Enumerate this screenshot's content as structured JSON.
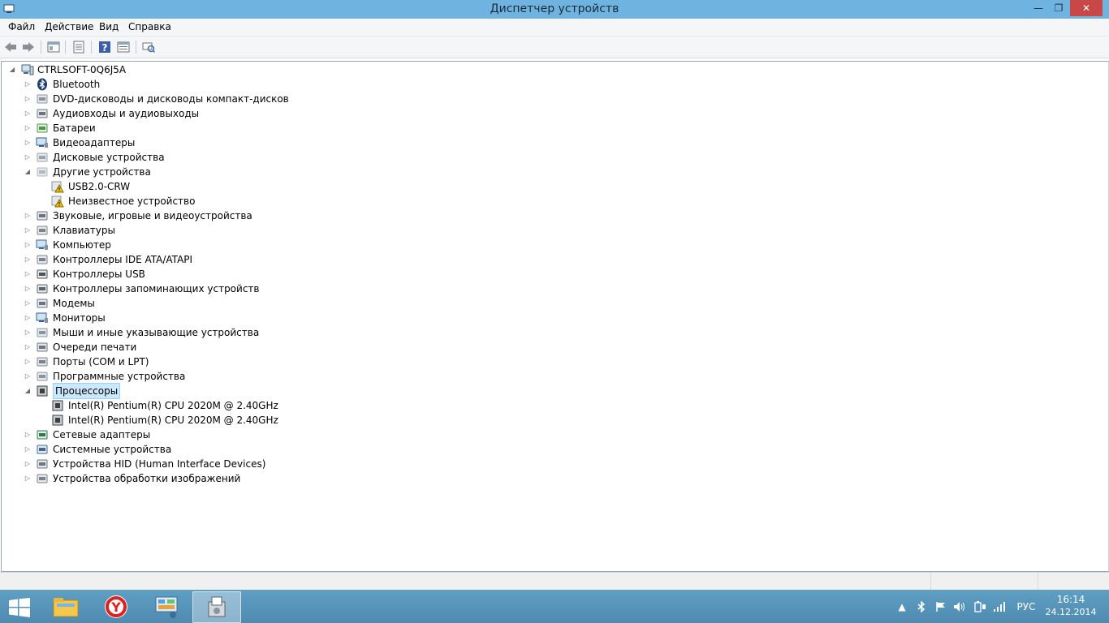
{
  "window": {
    "title": "Диспетчер устройств",
    "minimize": "—",
    "maximize": "❐",
    "close": "✕"
  },
  "menu": [
    "Файл",
    "Действие",
    "Вид",
    "Справка"
  ],
  "toolbar": [
    "back-icon",
    "forward-icon",
    "properties-icon",
    "show-hide-icon",
    "help-icon",
    "action-icon",
    "scan-hardware-icon"
  ],
  "tree": {
    "root": "CTRLSOFT-0Q6J5A",
    "items": [
      {
        "label": "Bluetooth",
        "icon": "bluetooth-icon",
        "level": 1,
        "expander": "collapsed"
      },
      {
        "label": "DVD-дисководы и дисководы компакт-дисков",
        "icon": "dvd-drive-icon",
        "level": 1,
        "expander": "collapsed"
      },
      {
        "label": "Аудиовходы и аудиовыходы",
        "icon": "speaker-icon",
        "level": 1,
        "expander": "collapsed"
      },
      {
        "label": "Батареи",
        "icon": "battery-icon",
        "level": 1,
        "expander": "collapsed"
      },
      {
        "label": "Видеоадаптеры",
        "icon": "display-adapter-icon",
        "level": 1,
        "expander": "collapsed"
      },
      {
        "label": "Дисковые устройства",
        "icon": "disk-drive-icon",
        "level": 1,
        "expander": "collapsed"
      },
      {
        "label": "Другие устройства",
        "icon": "unknown-device-icon",
        "level": 1,
        "expander": "expanded"
      },
      {
        "label": "USB2.0-CRW",
        "icon": "warning-device-icon",
        "level": 2,
        "expander": "none"
      },
      {
        "label": "Неизвестное устройство",
        "icon": "warning-device-icon",
        "level": 2,
        "expander": "none"
      },
      {
        "label": "Звуковые, игровые и видеоустройства",
        "icon": "sound-icon",
        "level": 1,
        "expander": "collapsed"
      },
      {
        "label": "Клавиатуры",
        "icon": "keyboard-icon",
        "level": 1,
        "expander": "collapsed"
      },
      {
        "label": "Компьютер",
        "icon": "computer-icon",
        "level": 1,
        "expander": "collapsed"
      },
      {
        "label": "Контроллеры IDE ATA/ATAPI",
        "icon": "ide-controller-icon",
        "level": 1,
        "expander": "collapsed"
      },
      {
        "label": "Контроллеры USB",
        "icon": "usb-icon",
        "level": 1,
        "expander": "collapsed"
      },
      {
        "label": "Контроллеры запоминающих устройств",
        "icon": "storage-controller-icon",
        "level": 1,
        "expander": "collapsed"
      },
      {
        "label": "Модемы",
        "icon": "modem-icon",
        "level": 1,
        "expander": "collapsed"
      },
      {
        "label": "Мониторы",
        "icon": "monitor-icon",
        "level": 1,
        "expander": "collapsed"
      },
      {
        "label": "Мыши и иные указывающие устройства",
        "icon": "mouse-icon",
        "level": 1,
        "expander": "collapsed"
      },
      {
        "label": "Очереди печати",
        "icon": "printer-icon",
        "level": 1,
        "expander": "collapsed"
      },
      {
        "label": "Порты (COM и LPT)",
        "icon": "port-icon",
        "level": 1,
        "expander": "collapsed"
      },
      {
        "label": "Программные устройства",
        "icon": "software-device-icon",
        "level": 1,
        "expander": "collapsed"
      },
      {
        "label": "Процессоры",
        "icon": "processor-icon",
        "level": 1,
        "expander": "expanded",
        "selected": true
      },
      {
        "label": "Intel(R) Pentium(R) CPU 2020M @ 2.40GHz",
        "icon": "processor-icon",
        "level": 2,
        "expander": "none"
      },
      {
        "label": "Intel(R) Pentium(R) CPU 2020M @ 2.40GHz",
        "icon": "processor-icon",
        "level": 2,
        "expander": "none"
      },
      {
        "label": "Сетевые адаптеры",
        "icon": "network-adapter-icon",
        "level": 1,
        "expander": "collapsed"
      },
      {
        "label": "Системные устройства",
        "icon": "system-device-icon",
        "level": 1,
        "expander": "collapsed"
      },
      {
        "label": "Устройства HID (Human Interface Devices)",
        "icon": "hid-icon",
        "level": 1,
        "expander": "collapsed"
      },
      {
        "label": "Устройства обработки изображений",
        "icon": "imaging-device-icon",
        "level": 1,
        "expander": "collapsed"
      }
    ]
  },
  "taskbar": {
    "apps": [
      "file-explorer-icon",
      "yandex-browser-icon",
      "control-panel-icon",
      "device-manager-icon"
    ],
    "tray": {
      "language": "РУС",
      "time": "16:14",
      "date": "24.12.2014"
    }
  },
  "colors": {
    "titlebar": "#6fb3e0",
    "close": "#c84747",
    "selection": "#cce8ff",
    "taskbar": "#5f9fc4"
  }
}
